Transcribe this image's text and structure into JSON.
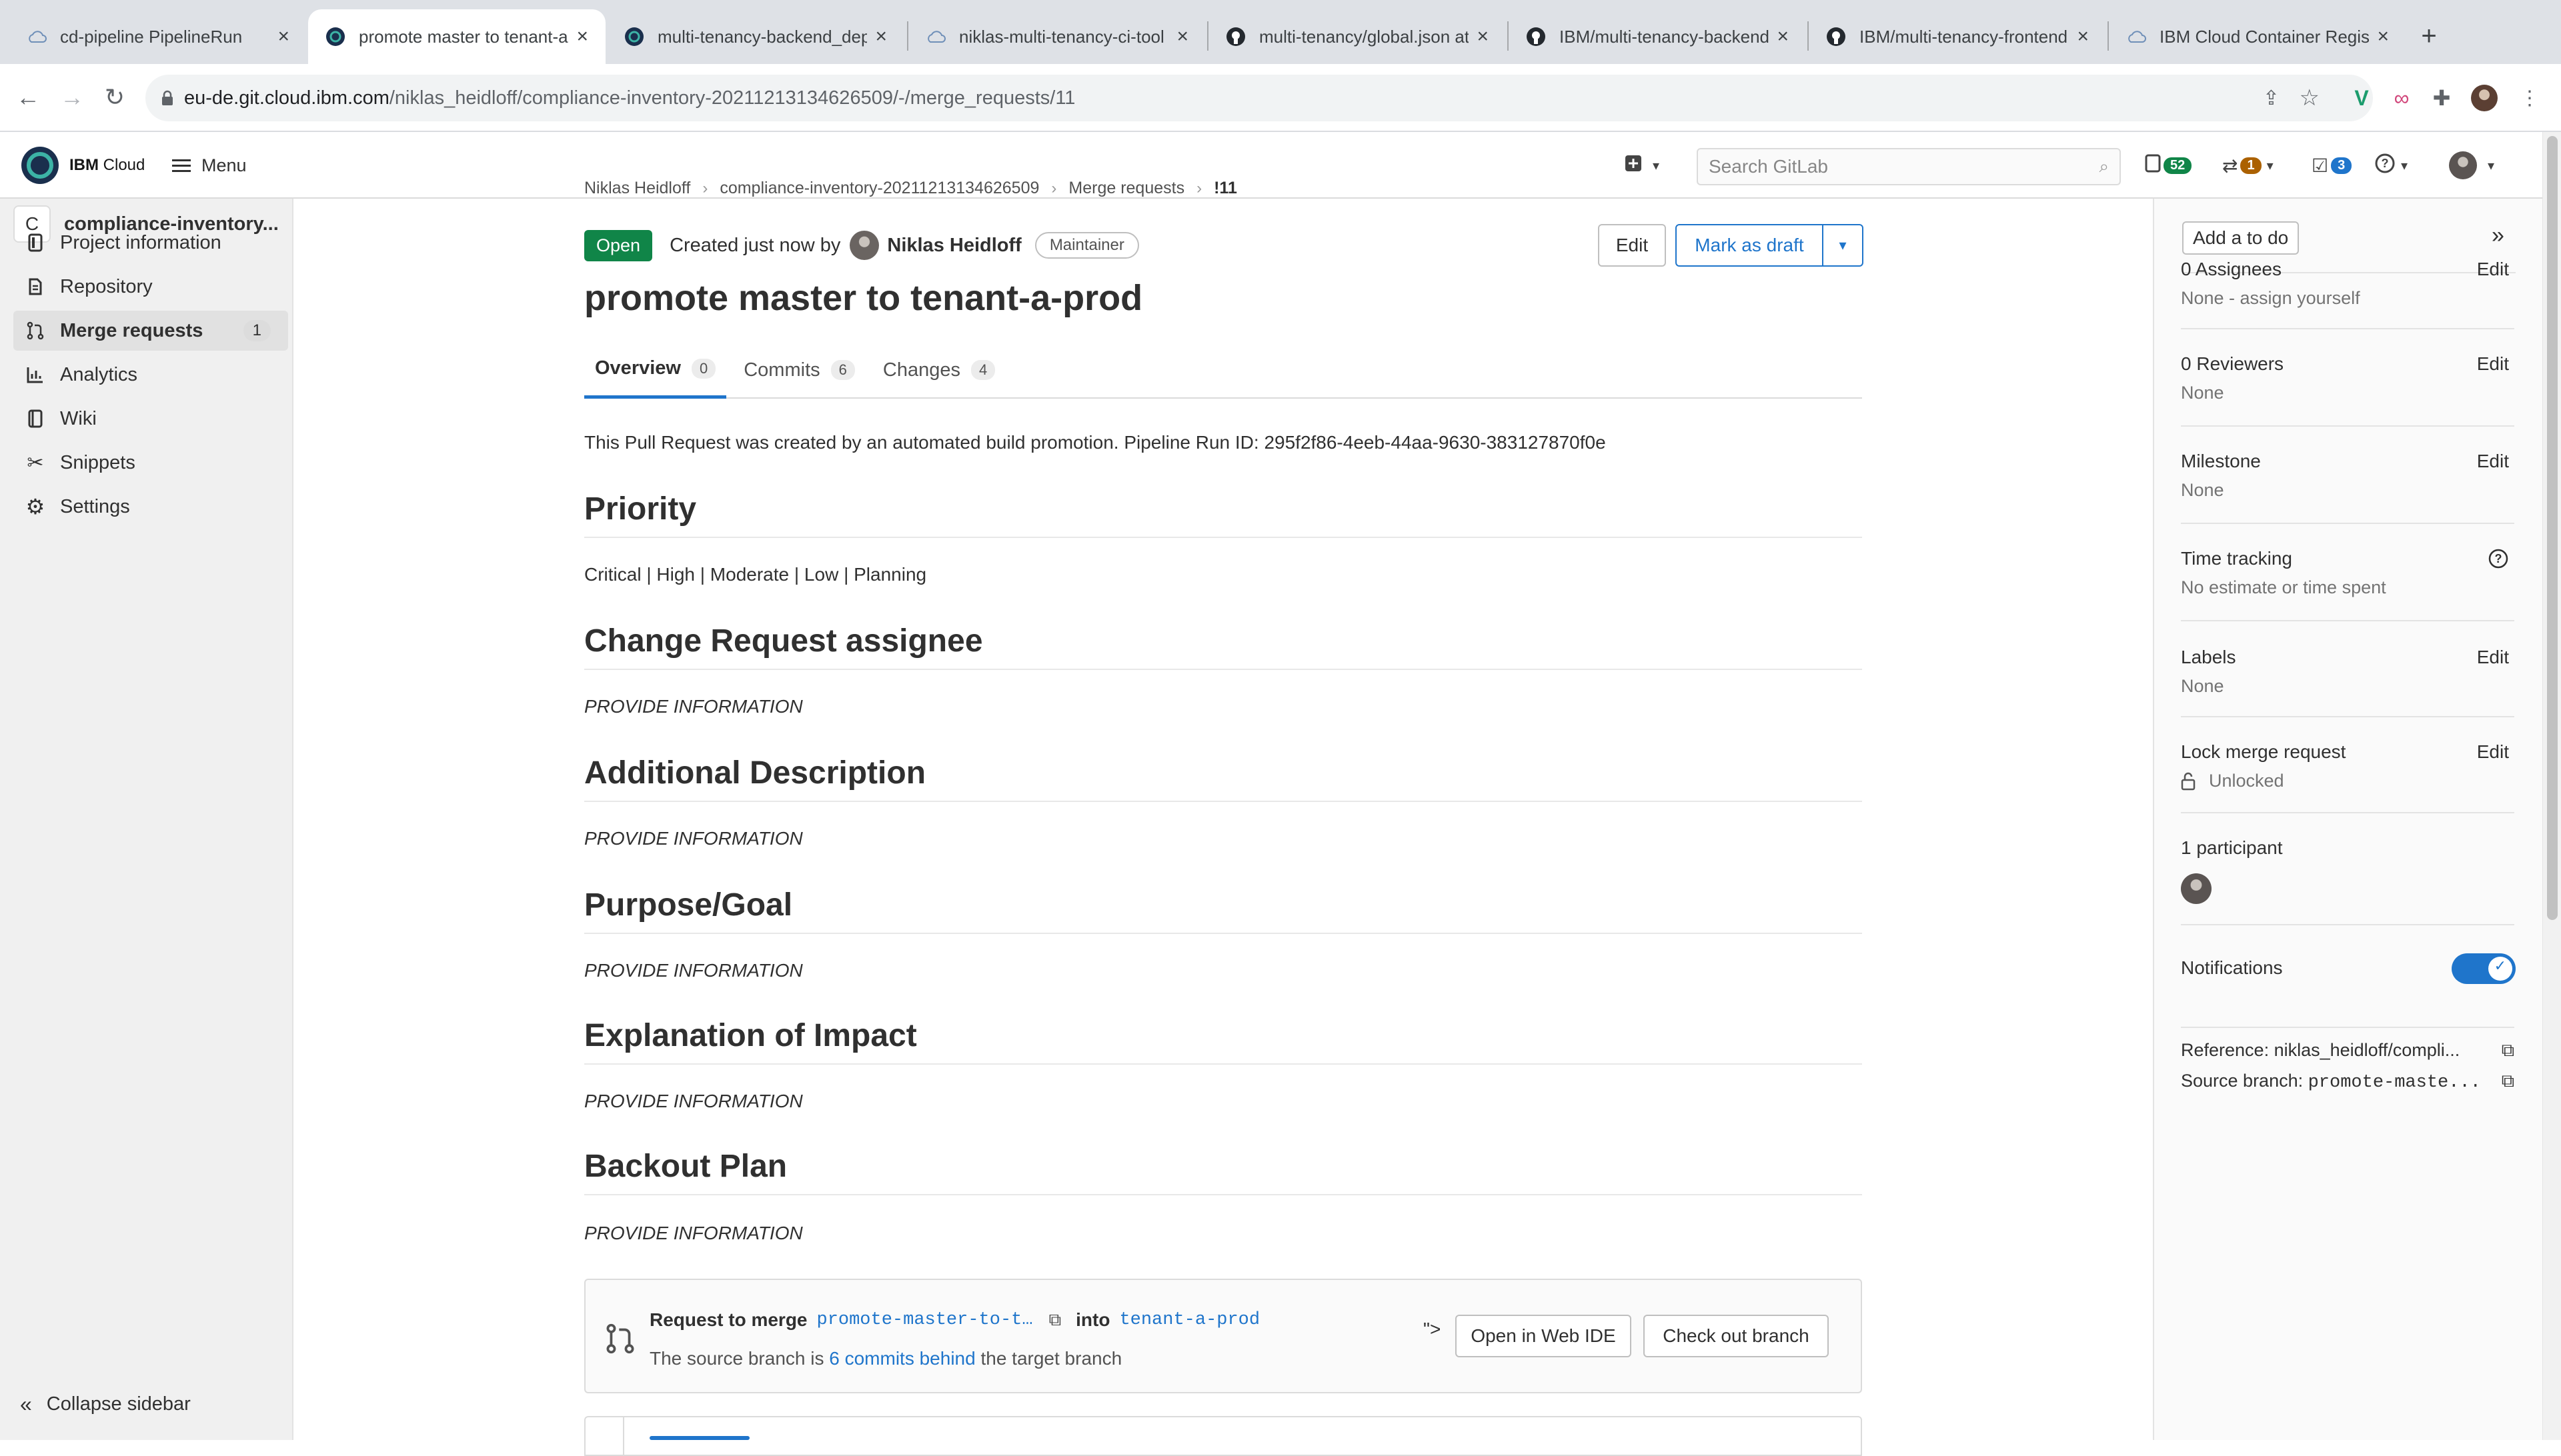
{
  "browser": {
    "tabs": [
      {
        "title": "cd-pipeline PipelineRun",
        "icon": "cloud-icon"
      },
      {
        "title": "promote master to tenant-a",
        "icon": "ibm-cloud-icon"
      },
      {
        "title": "multi-tenancy-backend_dep",
        "icon": "ibm-cloud-icon"
      },
      {
        "title": "niklas-multi-tenancy-ci-tool",
        "icon": "cloud-icon"
      },
      {
        "title": "multi-tenancy/global.json at",
        "icon": "github-icon"
      },
      {
        "title": "IBM/multi-tenancy-backend",
        "icon": "github-icon"
      },
      {
        "title": "IBM/multi-tenancy-frontend",
        "icon": "github-icon"
      },
      {
        "title": "IBM Cloud Container Regist",
        "icon": "cloud-icon"
      }
    ],
    "url_host": "eu-de.git.cloud.ibm.com",
    "url_path": "/niklas_heidloff/compliance-inventory-20211213134626509/-/merge_requests/11"
  },
  "header": {
    "brand_strong": "IBM",
    "brand_rest": " Cloud",
    "menu_label": "Menu",
    "search_placeholder": "Search GitLab",
    "issues_count": "52",
    "mr_count": "1",
    "todo_count": "3"
  },
  "sidebar": {
    "project_initial": "C",
    "project_name": "compliance-inventory...",
    "items": [
      {
        "label": "Project information"
      },
      {
        "label": "Repository"
      },
      {
        "label": "Merge requests",
        "count": "1"
      },
      {
        "label": "Analytics"
      },
      {
        "label": "Wiki"
      },
      {
        "label": "Snippets"
      },
      {
        "label": "Settings"
      }
    ],
    "collapse_label": "Collapse sidebar"
  },
  "breadcrumb": [
    "Niklas Heidloff",
    "compliance-inventory-20211213134626509",
    "Merge requests",
    "!11"
  ],
  "mr": {
    "status": "Open",
    "created_text": "Created just now by",
    "author": "Niklas Heidloff",
    "role": "Maintainer",
    "edit_label": "Edit",
    "draft_label": "Mark as draft",
    "title": "promote master to tenant-a-prod",
    "tabs": [
      {
        "label": "Overview",
        "count": "0"
      },
      {
        "label": "Commits",
        "count": "6"
      },
      {
        "label": "Changes",
        "count": "4"
      }
    ],
    "description": "This Pull Request was created by an automated build promotion. Pipeline Run ID: 295f2f86-4eeb-44aa-9630-383127870f0e",
    "sections": [
      {
        "heading": "Priority",
        "body": "Critical | High | Moderate | Low | Planning"
      },
      {
        "heading": "Change Request assignee",
        "body": "PROVIDE INFORMATION"
      },
      {
        "heading": "Additional Description",
        "body": "PROVIDE INFORMATION"
      },
      {
        "heading": "Purpose/Goal",
        "body": "PROVIDE INFORMATION"
      },
      {
        "heading": "Explanation of Impact",
        "body": "PROVIDE INFORMATION"
      },
      {
        "heading": "Backout Plan",
        "body": "PROVIDE INFORMATION"
      }
    ],
    "merge": {
      "request_label": "Request to merge",
      "source": "promote-master-to-t…",
      "into_label": "into",
      "target": "tenant-a-prod",
      "stray": "\">",
      "line2_prefix": "The source branch is",
      "behind_link": "6 commits behind",
      "line2_suffix": "the target branch",
      "web_ide_label": "Open in Web IDE",
      "checkout_label": "Check out branch"
    }
  },
  "right_sidebar": {
    "todo_label": "Add a to do",
    "assignees_title": "0 Assignees",
    "assignees_value": "None - assign yourself",
    "reviewers_title": "0 Reviewers",
    "reviewers_value": "None",
    "milestone_title": "Milestone",
    "milestone_value": "None",
    "time_title": "Time tracking",
    "time_value": "No estimate or time spent",
    "labels_title": "Labels",
    "labels_value": "None",
    "lock_title": "Lock merge request",
    "lock_value": "Unlocked",
    "participants_title": "1 participant",
    "notifications_title": "Notifications",
    "notifications_on": true,
    "edit_label": "Edit",
    "reference": "Reference: niklas_heidloff/compli...",
    "source_branch_label": "Source branch: ",
    "source_branch_value": "promote-maste..."
  },
  "colors": {
    "open": "#108548",
    "link": "#1f75cb",
    "issues_badge": "#108548",
    "mr_badge": "#ab6100",
    "todo_badge": "#1f75cb"
  }
}
